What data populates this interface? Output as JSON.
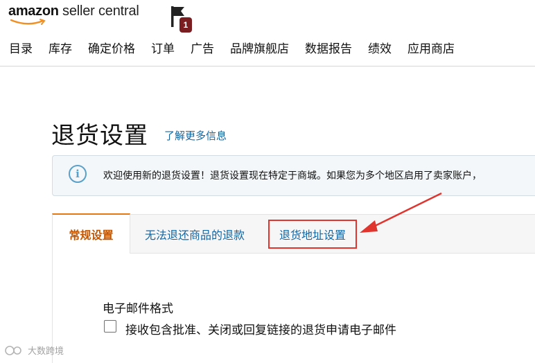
{
  "header": {
    "logo_brand": "amazon",
    "logo_suffix": " seller central",
    "notification_count": "1",
    "nav": [
      "目录",
      "库存",
      "确定价格",
      "订单",
      "广告",
      "品牌旗舰店",
      "数据报告",
      "绩效",
      "应用商店"
    ]
  },
  "page": {
    "title": "退货设置",
    "learn_more": "了解更多信息",
    "info_text": "欢迎使用新的退货设置！退货设置现在特定于商城。如果您为多个地区启用了卖家账户，"
  },
  "tabs": {
    "general": "常规设置",
    "refund": "无法退还商品的退款",
    "address": "退货地址设置"
  },
  "email": {
    "section_label": "电子邮件格式",
    "checkbox_label": "接收包含批准、关闭或回复链接的退货申请电子邮件",
    "checked": false
  },
  "watermark": "大数跨境",
  "colors": {
    "tab_active": "#c45500",
    "tab_active_border": "#e47911",
    "link": "#1366a3",
    "highlight": "#e0342e",
    "badge": "#7a1e22",
    "info_icon": "#5aa0c8"
  },
  "icons": {
    "flag": "flag-icon",
    "info": "info-icon",
    "arrow": "red-arrow-annotation"
  }
}
